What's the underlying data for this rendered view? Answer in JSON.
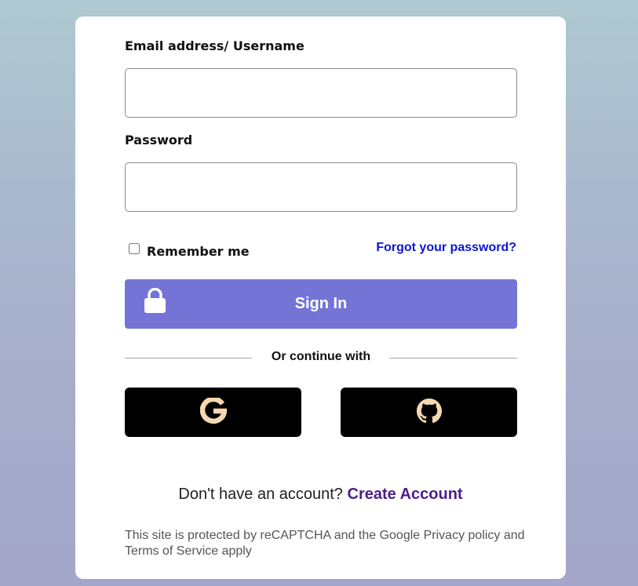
{
  "form": {
    "email_label": "Email address/ Username",
    "email_value": "",
    "password_label": "Password",
    "password_value": "",
    "remember_label": "Remember me",
    "remember_checked": false,
    "forgot_link": "Forgot your password?",
    "signin_label": "Sign In",
    "signin_icon": "lock-icon",
    "divider_text": "Or continue with"
  },
  "social": [
    {
      "name": "Google",
      "icon": "google-icon"
    },
    {
      "name": "GitHub",
      "icon": "github-icon"
    }
  ],
  "signup": {
    "prompt": "Don't have an account?",
    "link": "Create Account"
  },
  "legal": "This site is protected by reCAPTCHA and the Google Privacy policy and Terms of Service apply",
  "colors": {
    "primary_button": "#7374d6",
    "link_blue": "#0a16d0",
    "create_account": "#4a1f8a",
    "social_button_bg": "#000000",
    "social_icon": "#f5d8b0"
  }
}
